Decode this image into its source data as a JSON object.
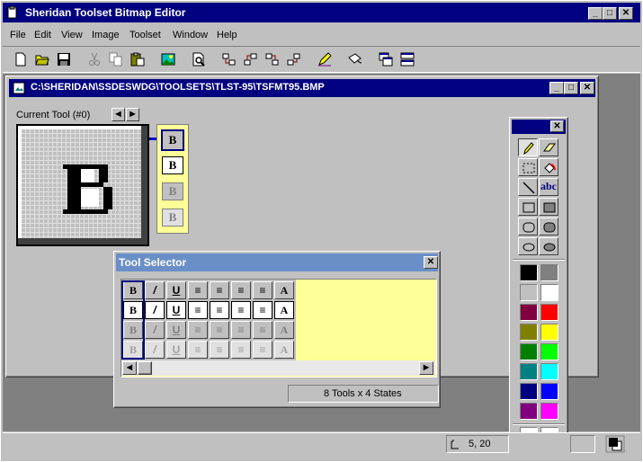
{
  "app": {
    "title": "Sheridan Toolset Bitmap Editor",
    "menu": [
      "File",
      "Edit",
      "View",
      "Image",
      "Toolset",
      "Window",
      "Help"
    ]
  },
  "toolbar": {
    "buttons": [
      "new-icon",
      "open-icon",
      "save-icon",
      "cut-icon",
      "copy-icon",
      "paste-icon",
      "image-icon",
      "print-preview-icon",
      "toolset-icon-1",
      "toolset-icon-2",
      "toolset-icon-3",
      "toolset-icon-4",
      "edit-pencil-icon",
      "paint-icon",
      "window-cascade-icon",
      "window-tile-icon"
    ]
  },
  "document": {
    "title": "C:\\SHERIDAN\\SSDESWDG\\TOOLSETS\\TLST-95\\TSFMT95.BMP",
    "current_tool_label": "Current Tool (#0)",
    "glyph": "B"
  },
  "tool_selector": {
    "title": "Tool Selector",
    "status": "8 Tools x 4 States",
    "glyphs": [
      "B",
      "/",
      "U",
      "≡",
      "≡",
      "≡",
      "≡",
      "A"
    ],
    "highlight_color": "#ffff99"
  },
  "palette": {
    "tools": [
      "pencil-icon",
      "eraser-icon",
      "select-rect-icon",
      "fill-icon",
      "line-icon",
      "text-icon",
      "rect-icon",
      "filled-rect-icon",
      "rounded-rect-icon",
      "filled-rounded-rect-icon",
      "ellipse-icon",
      "filled-ellipse-icon"
    ],
    "text_tool_label": "abc",
    "colors": [
      "#000000",
      "#808080",
      "#c0c0c0",
      "#ffffff",
      "#800040",
      "#ff0000",
      "#808000",
      "#ffff00",
      "#008000",
      "#00ff00",
      "#008080",
      "#00ffff",
      "#000080",
      "#0000ff",
      "#800080",
      "#ff00ff"
    ],
    "fg": "#ffffff",
    "bg": "#ffffff"
  },
  "status": {
    "coords": "5, 20"
  }
}
